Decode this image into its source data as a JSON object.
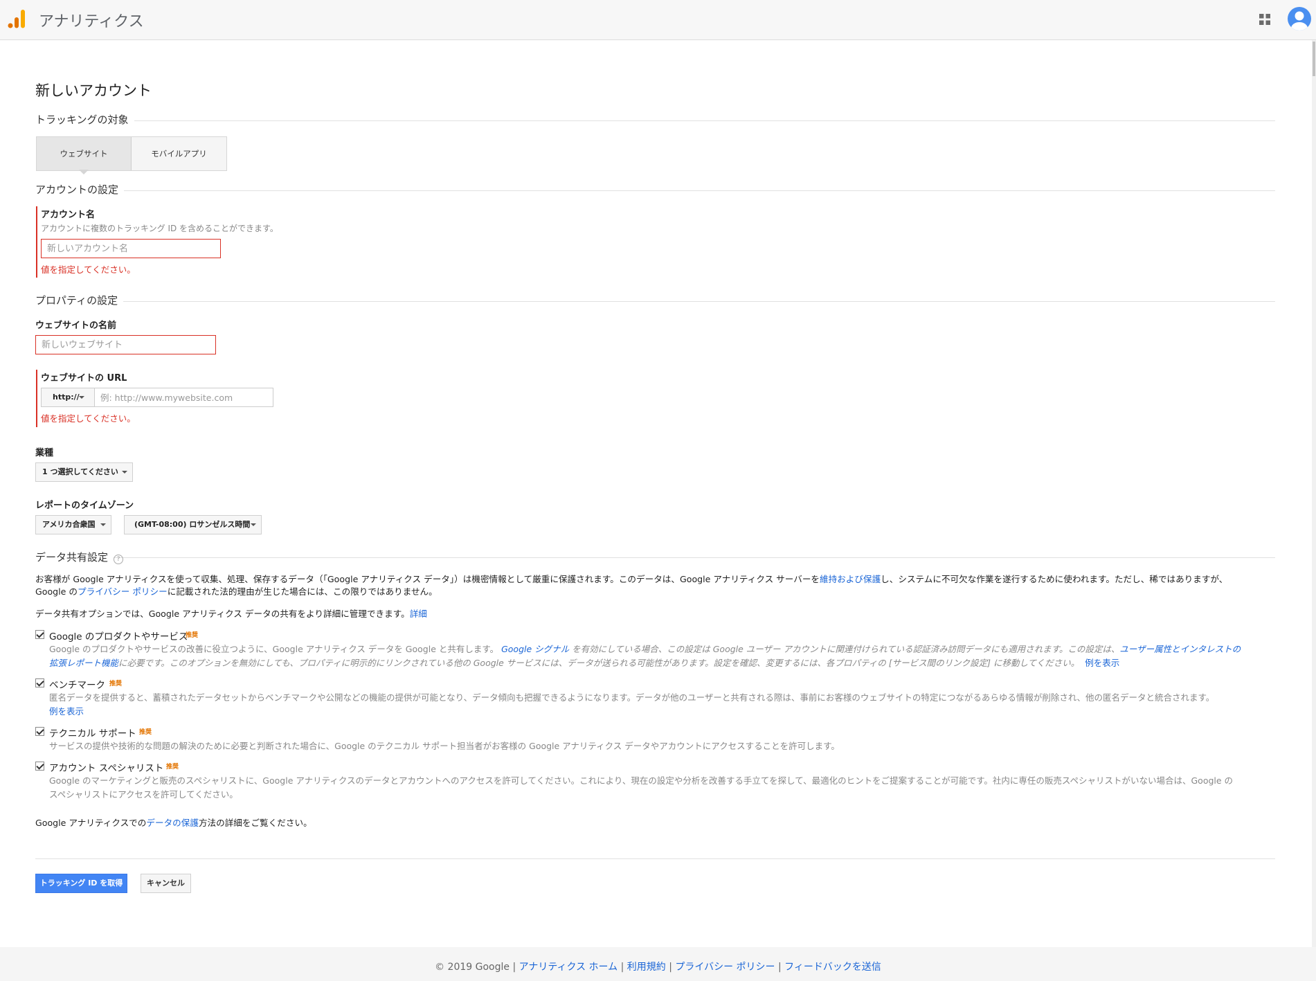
{
  "header": {
    "app_title": "アナリティクス",
    "apps_icon": "grid-apps-icon",
    "avatar_icon": "account-avatar-icon",
    "accent_color": "#f9ab00"
  },
  "page_title": "新しいアカウント",
  "tracking": {
    "heading": "トラッキングの対象",
    "tabs": [
      "ウェブサイト",
      "モバイルアプリ"
    ],
    "selected": "ウェブサイト"
  },
  "account": {
    "heading": "アカウントの設定",
    "name_label": "アカウント名",
    "name_hint": "アカウントに複数のトラッキング ID を含めることができます。",
    "name_placeholder": "新しいアカウント名",
    "name_error": "値を指定してください。"
  },
  "property": {
    "heading": "プロパティの設定",
    "site_name_label": "ウェブサイトの名前",
    "site_name_placeholder": "新しいウェブサイト",
    "url_label": "ウェブサイトの URL",
    "url_protocol": "http://",
    "url_placeholder": "例: http://www.mywebsite.com",
    "url_error": "値を指定してください。",
    "industry_label": "業種",
    "industry_value": "1 つ選択してください",
    "timezone_label": "レポートのタイムゾーン",
    "country_value": "アメリカ合衆国",
    "timezone_value": "(GMT-08:00) ロサンゼルス時間"
  },
  "sharing": {
    "heading": "データ共有設定",
    "help_icon": "?",
    "intro_1": "お客様が Google アナリティクスを使って収集、処理、保存するデータ（「Google アナリティクス データ」）は機密情報として厳重に保護されます。このデータは、Google アナリティクス サーバーを",
    "intro_link_1": "維持および保護",
    "intro_2": "し、システムに不可欠な作業を遂行するために使われます。ただし、稀ではありますが、",
    "intro_3": "Google の",
    "intro_link_2": "プライバシー ポリシー",
    "intro_4": "に記載された法的理由が生じた場合には、この限りではありません。",
    "options_text": "データ共有オプションでは、Google アナリティクス データの共有をより詳細に管理できます。",
    "options_link": "詳細",
    "badge": "推奨",
    "opt1_title": "Google のプロダクトやサービス",
    "opt1_desc_a": "Google のプロダクトやサービスの改善に役立つように、Google アナリティクス データを Google と共有します。",
    "opt1_link_a": "Google シグナル",
    "opt1_desc_b": "を有効にしている場合、この設定は Google ユーザー アカウントに関連付けられている認証済み訪問データにも適用されます。この設定は、",
    "opt1_link_b": "ユーザー属性とインタレストの",
    "opt1_link_c": "拡張レポート機能",
    "opt1_desc_c": "に必要です。このオプションを無効にしても、プロパティに明示的にリンクされている他の Google サービスには、データが送られる可能性があります。設定を確認、変更するには、各プロパティの [サービス間のリンク設定] に移動してください。",
    "opt1_link_d": "例を表示",
    "opt2_title": "ベンチマーク",
    "opt2_desc": "匿名データを提供すると、蓄積されたデータセットからベンチマークや公開などの機能の提供が可能となり、データ傾向も把握できるようになります。データが他のユーザーと共有される際は、事前にお客様のウェブサイトの特定につながるあらゆる情報が削除され、他の匿名データと統合されます。",
    "opt2_link": "例を表示",
    "opt3_title": "テクニカル サポート",
    "opt3_desc": "サービスの提供や技術的な問題の解決のために必要と判断された場合に、Google のテクニカル サポート担当者がお客様の Google アナリティクス データやアカウントにアクセスすることを許可します。",
    "opt4_title": "アカウント スペシャリスト",
    "opt4_desc_1": "Google のマーケティングと販売のスペシャリストに、Google アナリティクスのデータとアカウントへのアクセスを許可してください。これにより、現在の設定や分析を改善する手立てを探して、最適化のヒントをご提案することが可能です。社内に専任の販売スペシャリストがいない場合は、Google の",
    "opt4_desc_2": "スペシャリストにアクセスを許可してください。",
    "protect_1": "Google アナリティクスでの",
    "protect_link": "データの保護",
    "protect_2": "方法の詳細をご覧ください。"
  },
  "buttons": {
    "submit": "トラッキング ID を取得",
    "cancel": "キャンセル",
    "primary_color": "#4285f4"
  },
  "footer": {
    "copyright": "© 2019 Google",
    "links": [
      "アナリティクス ホーム",
      "利用規約",
      "プライバシー ポリシー",
      "フィードバックを送信"
    ]
  }
}
